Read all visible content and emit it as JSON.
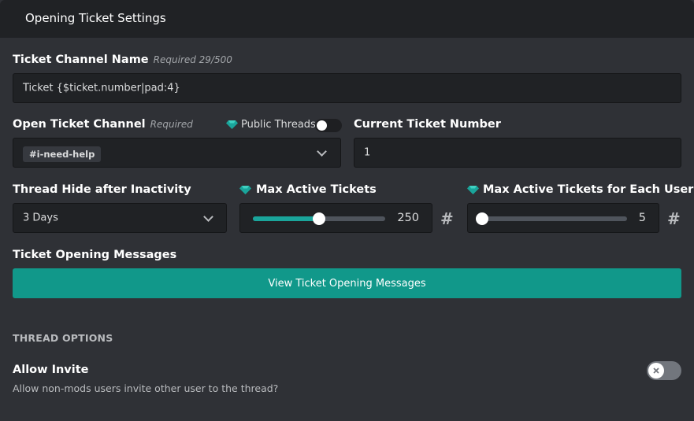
{
  "header": {
    "title": "Opening Ticket Settings"
  },
  "channel_name": {
    "label": "Ticket Channel Name",
    "hint": "Required 29/500",
    "value": "Ticket {$ticket.number|pad:4}"
  },
  "open_channel": {
    "label": "Open Ticket Channel",
    "hint": "Required",
    "selected": "#i-need-help",
    "public_threads_label": "Public Threads",
    "public_threads_enabled": true
  },
  "current_number": {
    "label": "Current Ticket Number",
    "value": "1"
  },
  "hide_after": {
    "label": "Thread Hide after Inactivity",
    "selected": "3 Days"
  },
  "max_active": {
    "label": "Max Active Tickets",
    "value": "250",
    "fill_fraction": 0.5,
    "unit_symbol": "#"
  },
  "max_per_user": {
    "label": "Max Active Tickets for Each User",
    "value": "5",
    "fill_fraction": 0.0,
    "unit_symbol": "#"
  },
  "opening_messages": {
    "label": "Ticket Opening Messages",
    "button_label": "View Ticket Opening Messages"
  },
  "thread_options": {
    "section_title": "THREAD OPTIONS",
    "allow_invite": {
      "label": "Allow Invite",
      "description": "Allow non-mods users invite other user to the thread?",
      "enabled": false
    }
  },
  "colors": {
    "accent": "#11988a",
    "slider_fill": "#1aa59b",
    "background": "#2f3136",
    "header": "#202225",
    "input": "#202225"
  },
  "icons": {
    "premium": "gem-icon",
    "dropdown": "chevron-down-icon",
    "toggle_off": "close-icon",
    "unit": "hash-icon"
  }
}
